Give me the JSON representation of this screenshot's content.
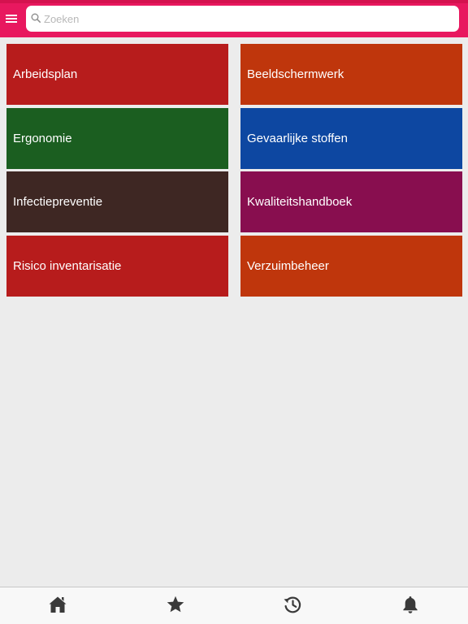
{
  "header": {
    "background_color": "#e8185f",
    "menu_icon": "hamburger-menu-icon",
    "search": {
      "placeholder": "Zoeken",
      "value": "",
      "icon": "search-icon"
    }
  },
  "tiles": [
    {
      "label": "Arbeidsplan",
      "color": "#b71c1c"
    },
    {
      "label": "Beeldschermwerk",
      "color": "#bf360c"
    },
    {
      "label": "Ergonomie",
      "color": "#1b5e20"
    },
    {
      "label": "Gevaarlijke stoffen",
      "color": "#0d47a1"
    },
    {
      "label": "Infectiepreventie",
      "color": "#3e2723"
    },
    {
      "label": "Kwaliteitshandboek",
      "color": "#880e4f"
    },
    {
      "label": "Risico inventarisatie",
      "color": "#b71c1c"
    },
    {
      "label": "Verzuimbeheer",
      "color": "#bf360c"
    }
  ],
  "tabbar": {
    "items": [
      {
        "icon": "home-icon"
      },
      {
        "icon": "star-icon"
      },
      {
        "icon": "history-icon"
      },
      {
        "icon": "bell-icon"
      }
    ],
    "icon_color": "#3a3a3a"
  }
}
